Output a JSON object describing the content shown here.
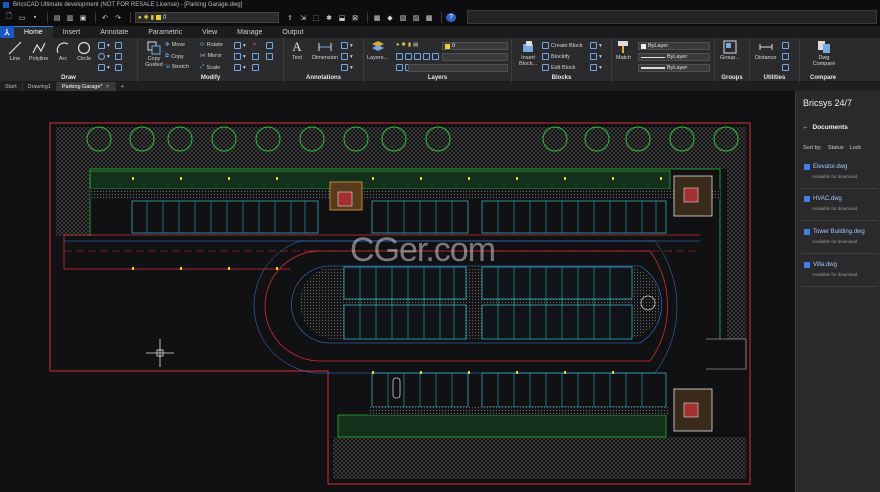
{
  "window": {
    "title": "BricsCAD Ultimate development (NOT FOR RESALE License) - [Parking Garage.dwg]"
  },
  "quick_access": {
    "layer_value": "0"
  },
  "ribbon_tabs": [
    "Home",
    "Insert",
    "Annotate",
    "Parametric",
    "View",
    "Manage",
    "Output"
  ],
  "draw": {
    "title": "Draw",
    "line": "Line",
    "polyline": "Polyline",
    "arc": "Arc",
    "circle": "Circle"
  },
  "modify": {
    "title": "Modify",
    "copy_guided": "Copy Guided",
    "move": "Move",
    "copy": "Copy",
    "stretch": "Stretch",
    "rotate": "Rotate",
    "mirror": "Mirror",
    "scale": "Scale"
  },
  "annotations": {
    "title": "Annotations",
    "text": "Text",
    "dimension": "Dimension"
  },
  "layers": {
    "title": "Layers",
    "layers_btn": "Layers...",
    "current": "0"
  },
  "blocks": {
    "title": "Blocks",
    "insert": "Insert Block...",
    "create": "Create Block",
    "blockify": "Blockify",
    "edit": "Edit Block"
  },
  "properties": {
    "match": "Match",
    "bylayer1": "ByLayer",
    "bylayer2": "ByLayer",
    "bylayer3": "ByLayer"
  },
  "groups": {
    "title": "Groups",
    "btn": "Group..."
  },
  "utilities": {
    "title": "Utilities",
    "distance": "Distance"
  },
  "compare": {
    "title": "Compare",
    "btn": "Dwg Compare"
  },
  "doc_tabs": [
    "Start",
    "Drawing1",
    "Parking Garage*"
  ],
  "watermark": "CGer.com",
  "sidebar": {
    "title": "Bricsys 24/7",
    "documents": "Documents",
    "sort_by": "Sort by:",
    "status": "Status",
    "lock": "Lock",
    "files": [
      {
        "name": "Elevator.dwg",
        "status": "Available for download"
      },
      {
        "name": "HVAC.dwg",
        "status": "Available for download"
      },
      {
        "name": "Tower Building.dwg",
        "status": "Available for download"
      },
      {
        "name": "Villa.dwg",
        "status": "Available for download"
      }
    ]
  },
  "colors": {
    "accent": "#3a7fe0",
    "canvas": "#111114",
    "green": "#2fbf3a",
    "red": "#d23030",
    "cyan": "#39c6d8"
  }
}
